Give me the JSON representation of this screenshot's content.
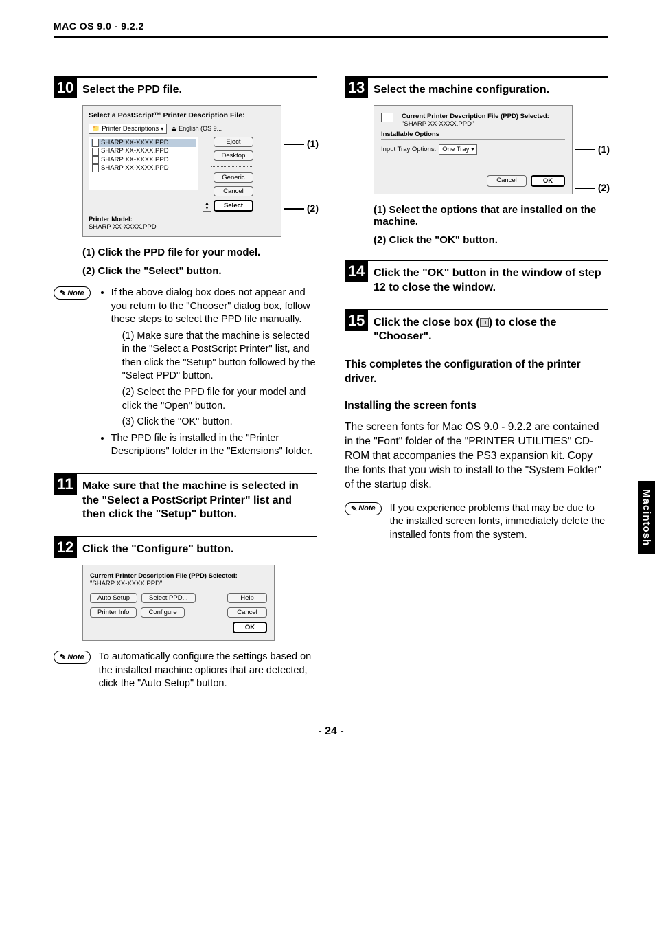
{
  "header": "MAC OS 9.0 - 9.2.2",
  "side_tab": "Macintosh",
  "page_number": "- 24 -",
  "left": {
    "step10": {
      "num": "10",
      "title": "Select the PPD file.",
      "dlg": {
        "title": "Select a PostScript™ Printer Description File:",
        "dropdown": "Printer Descriptions",
        "lang": "English (OS 9...",
        "items": [
          "SHARP XX-XXXX.PPD",
          "SHARP XX-XXXX.PPD",
          "SHARP XX-XXXX.PPD",
          "SHARP XX-XXXX.PPD"
        ],
        "btn_eject": "Eject",
        "btn_desktop": "Desktop",
        "btn_generic": "Generic",
        "btn_cancel": "Cancel",
        "btn_select": "Select",
        "model_label": "Printer Model:",
        "model_value": "SHARP XX-XXXX.PPD",
        "c1": "(1)",
        "c2": "(2)"
      },
      "sub1": "(1) Click the PPD file for your model.",
      "sub2": "(2) Click the \"Select\" button.",
      "note_label": "Note",
      "note_bullet1": "If the above dialog box does not appear and you return to the \"Chooser\" dialog box, follow these steps to select the PPD file manually.",
      "note_s1": "(1) Make sure that the machine is selected in the \"Select a PostScript Printer\" list, and then click the \"Setup\" button followed by the \"Select PPD\" button.",
      "note_s2": "(2) Select the PPD file for your model and click the \"Open\" button.",
      "note_s3": "(3) Click the \"OK\" button.",
      "note_bullet2": "The PPD file is installed in the \"Printer Descriptions\" folder in the \"Extensions\" folder."
    },
    "step11": {
      "num": "11",
      "title": "Make sure that the machine is selected in the \"Select a PostScript Printer\" list and then click the \"Setup\" button."
    },
    "step12": {
      "num": "12",
      "title": "Click the \"Configure\" button.",
      "dlg": {
        "title": "Current Printer Description File (PPD) Selected:",
        "file": "\"SHARP XX-XXXX.PPD\"",
        "btn_auto": "Auto Setup",
        "btn_selectppd": "Select PPD...",
        "btn_help": "Help",
        "btn_info": "Printer Info",
        "btn_configure": "Configure",
        "btn_cancel": "Cancel",
        "btn_ok": "OK"
      },
      "note_label": "Note",
      "note_text": "To automatically configure the settings based on the installed machine options that are detected, click the \"Auto Setup\" button."
    }
  },
  "right": {
    "step13": {
      "num": "13",
      "title": "Select the machine configuration.",
      "dlg": {
        "title": "Current Printer Description File (PPD) Selected:",
        "file": "\"SHARP XX-XXXX.PPD\"",
        "inst": "Installable Options",
        "opt_label": "Input Tray Options:",
        "opt_value": "One Tray",
        "btn_cancel": "Cancel",
        "btn_ok": "OK",
        "c1": "(1)",
        "c2": "(2)"
      },
      "sub1": "(1) Select the options that are installed on the machine.",
      "sub2": "(2) Click the \"OK\" button."
    },
    "step14": {
      "num": "14",
      "title": "Click the \"OK\" button in the window of step 12 to close the window."
    },
    "step15": {
      "num": "15",
      "title_a": "Click the close box (",
      "title_b": ") to close the \"Chooser\"."
    },
    "completion": "This completes the configuration of the printer driver.",
    "fonts_heading": "Installing the screen fonts",
    "fonts_body": "The screen fonts for Mac OS 9.0 - 9.2.2 are contained in the \"Font\" folder of the \"PRINTER UTILITIES\" CD-ROM that accompanies the PS3 expansion kit. Copy the fonts that you wish to install to the \"System Folder\" of the startup disk.",
    "note_label": "Note",
    "note_text": "If you experience problems that may be due to the installed screen fonts, immediately delete the installed fonts from the system."
  }
}
